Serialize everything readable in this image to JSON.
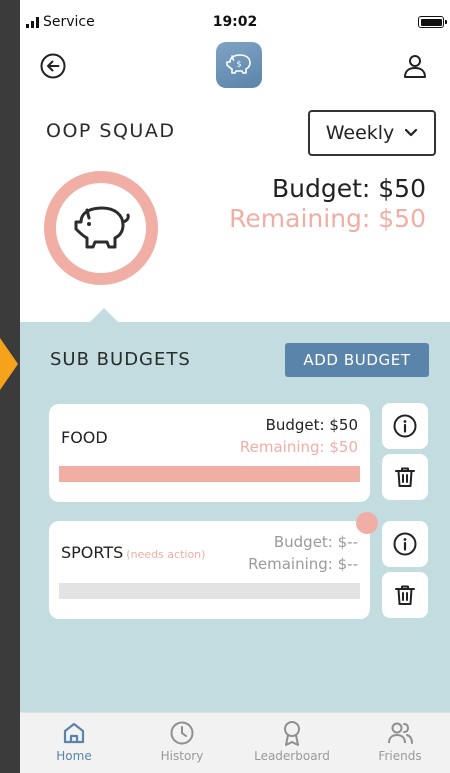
{
  "status_bar": {
    "carrier": "Service",
    "time": "19:02"
  },
  "header": {
    "group_name": "OOP SQUAD",
    "period": "Weekly"
  },
  "summary": {
    "budget": "Budget: $50",
    "remaining": "Remaining: $50"
  },
  "sub_budgets": {
    "title": "SUB BUDGETS",
    "add_label": "ADD BUDGET",
    "items": [
      {
        "name": "FOOD",
        "status": "",
        "budget": "Budget: $50",
        "remaining": "Remaining: $50",
        "progress": 1.0,
        "bar_color": "#f1aea4",
        "remaining_color": "#f1aea4"
      },
      {
        "name": "SPORTS",
        "status": "(needs action)",
        "budget": "Budget: $--",
        "remaining": "Remaining: $--",
        "progress": 1.0,
        "bar_color": "#e3e3e3",
        "remaining_color": "#9a9a9a"
      }
    ]
  },
  "tabs": [
    {
      "label": "Home",
      "icon": "home-icon",
      "active": true
    },
    {
      "label": "History",
      "icon": "clock-icon",
      "active": false
    },
    {
      "label": "Leaderboard",
      "icon": "award-icon",
      "active": false
    },
    {
      "label": "Friends",
      "icon": "users-icon",
      "active": false
    }
  ],
  "colors": {
    "accent": "#5b84ab",
    "salmon": "#f1aea4",
    "panel": "#c3dce0"
  }
}
